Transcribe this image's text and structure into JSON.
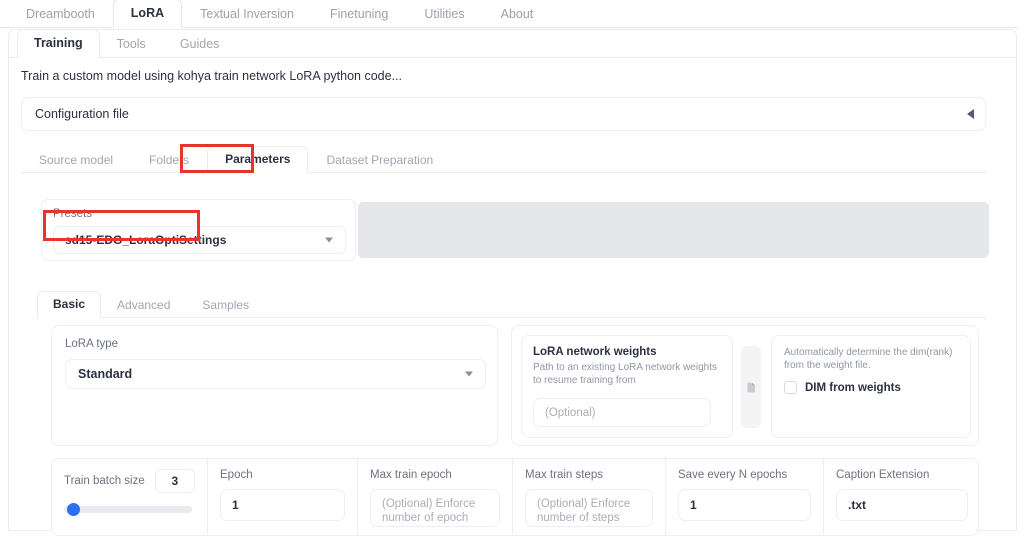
{
  "top_tabs": [
    {
      "label": "Dreambooth",
      "active": false
    },
    {
      "label": "LoRA",
      "active": true
    },
    {
      "label": "Textual Inversion",
      "active": false
    },
    {
      "label": "Finetuning",
      "active": false
    },
    {
      "label": "Utilities",
      "active": false
    },
    {
      "label": "About",
      "active": false
    }
  ],
  "sub_tabs": [
    {
      "label": "Training",
      "active": true
    },
    {
      "label": "Tools",
      "active": false
    },
    {
      "label": "Guides",
      "active": false
    }
  ],
  "description": "Train a custom model using kohya train network LoRA python code...",
  "configuration": {
    "label": "Configuration file",
    "collapse_icon": "triangle-left-icon"
  },
  "param_tabs": [
    {
      "label": "Source model",
      "active": false
    },
    {
      "label": "Folders",
      "active": false
    },
    {
      "label": "Parameters",
      "active": true,
      "highlighted": true
    },
    {
      "label": "Dataset Preparation",
      "active": false
    }
  ],
  "presets": {
    "label": "Presets",
    "value": "sd15-EDG_LoraOptiSettings",
    "highlighted": true,
    "caret_icon": "chevron-down-icon"
  },
  "basic_tabs": [
    {
      "label": "Basic",
      "active": true
    },
    {
      "label": "Advanced",
      "active": false
    },
    {
      "label": "Samples",
      "active": false
    }
  ],
  "lora_type": {
    "label": "LoRA type",
    "value": "Standard",
    "caret_icon": "chevron-down-icon"
  },
  "network_weights": {
    "title": "LoRA network weights",
    "subtitle": "Path to an existing LoRA network weights to resume training from",
    "input_placeholder": "(Optional)",
    "file_button_icon": "file-open-icon"
  },
  "dim_from_weights": {
    "description": "Automatically determine the dim(rank) from the weight file.",
    "checkbox_label": "DIM from weights",
    "checked": false
  },
  "parameters_row": [
    {
      "label": "Train batch size",
      "value": "3",
      "type": "slider",
      "slider_percent": 3
    },
    {
      "label": "Epoch",
      "value": "1",
      "type": "text"
    },
    {
      "label": "Max train epoch",
      "value": "",
      "placeholder": "(Optional) Enforce number of epoch",
      "type": "text"
    },
    {
      "label": "Max train steps",
      "value": "",
      "placeholder": "(Optional) Enforce number of steps",
      "type": "text"
    },
    {
      "label": "Save every N epochs",
      "value": "1",
      "type": "text"
    },
    {
      "label": "Caption Extension",
      "value": ".txt",
      "type": "text"
    }
  ],
  "colors": {
    "accent_blue": "#2f6ff5",
    "highlight_red": "#e8342a",
    "gray_panel": "#e5e7eb",
    "text_dark": "#2c3142",
    "text_muted": "#9ca0ab"
  }
}
